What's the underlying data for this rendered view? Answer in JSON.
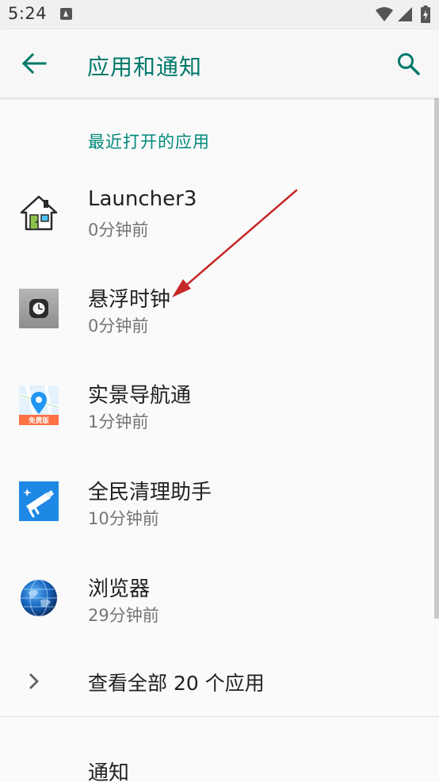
{
  "status_bar": {
    "time": "5:24"
  },
  "app_bar": {
    "title": "应用和通知",
    "back_icon": "arrow-back-icon",
    "search_icon": "search-icon"
  },
  "recent_apps": {
    "header": "最近打开的应用",
    "items": [
      {
        "name": "Launcher3",
        "time": "0分钟前",
        "icon": "launcher-house-icon"
      },
      {
        "name": "悬浮时钟",
        "time": "0分钟前",
        "icon": "floating-clock-icon"
      },
      {
        "name": "实景导航通",
        "time": "1分钟前",
        "icon": "map-navigation-icon",
        "icon_badge": "免费版"
      },
      {
        "name": "全民清理助手",
        "time": "10分钟前",
        "icon": "cleaner-brush-icon"
      },
      {
        "name": "浏览器",
        "time": "29分钟前",
        "icon": "globe-browser-icon"
      }
    ],
    "see_all": "查看全部 20 个应用"
  },
  "notifications": {
    "label": "通知"
  },
  "colors": {
    "accent": "#00796b",
    "header": "#00897b",
    "annotation_arrow": "#c62828"
  }
}
